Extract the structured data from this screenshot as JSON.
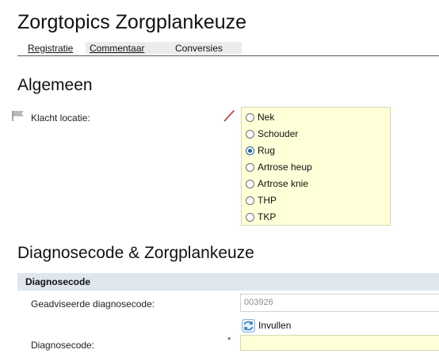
{
  "page": {
    "title": "Zorgtopics Zorgplankeuze"
  },
  "tabs": [
    {
      "label": "Registratie"
    },
    {
      "label": "Commentaar"
    },
    {
      "label": "Conversies"
    }
  ],
  "algemeen": {
    "heading": "Algemeen",
    "klacht_label": "Klacht locatie:",
    "options": [
      "Nek",
      "Schouder",
      "Rug",
      "Artrose heup",
      "Artrose knie",
      "THP",
      "TKP"
    ],
    "selected": "Rug"
  },
  "diagnose_section": {
    "heading": "Diagnosecode & Zorgplankeuze",
    "group_title": "Diagnosecode",
    "advised_label": "Geadviseerde diagnosecode:",
    "advised_value": "003926",
    "fill_button": "Invullen",
    "code_label": "Diagnosecode:",
    "required_mark": "*",
    "code_value": ""
  },
  "colors": {
    "field_highlight": "#ffffd8",
    "section_bar": "#dfe6ee",
    "radio_selected": "#1f5ea8",
    "pencil": "#cc2a2a"
  }
}
